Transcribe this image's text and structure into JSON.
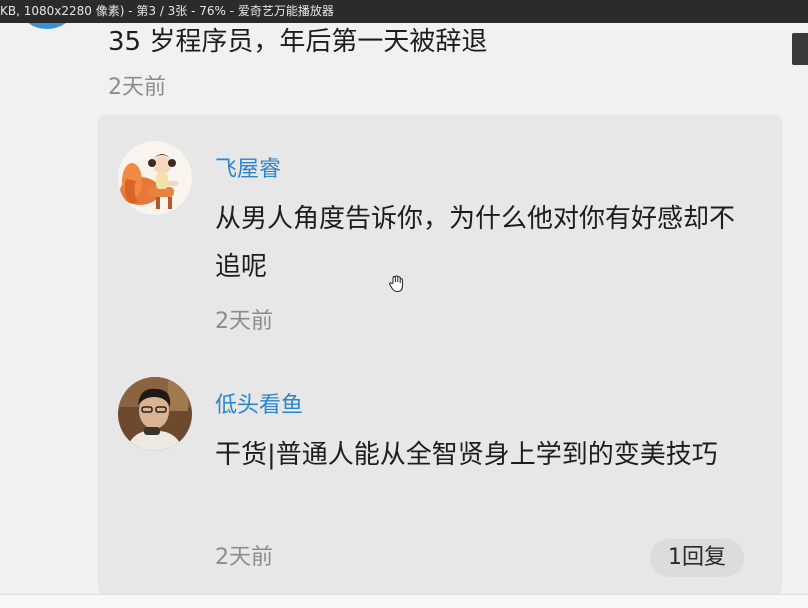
{
  "window": {
    "title": "KB, 1080x2280 像素) - 第3 / 3张 - 76% - 爱奇艺万能播放器"
  },
  "main_comment": {
    "text": "35 岁程序员，年后第一天被辞退",
    "time": "2天前"
  },
  "replies": [
    {
      "username": "飞屋睿",
      "text": "从男人角度告诉你，为什么他对你有好感却不追呢",
      "time": "2天前"
    },
    {
      "username": "低头看鱼",
      "text": "干货|普通人能从全智贤身上学到的变美技巧",
      "time": "2天前",
      "reply_count_label": "1回复"
    }
  ],
  "colors": {
    "username": "#2a86c9",
    "text": "#1d1d1d",
    "time": "#8c8c8c",
    "reply_box": "#e7e7e7"
  },
  "icons": {
    "cursor": "hand-cursor-icon",
    "avatar_1": "cartoon-girl-on-horse-avatar",
    "avatar_2": "young-man-photo-avatar"
  }
}
